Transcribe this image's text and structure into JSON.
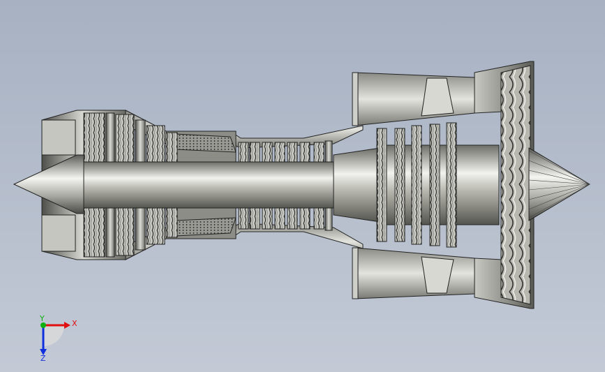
{
  "viewport": {
    "background_top": "#a7b1c2",
    "background_bottom": "#c3cad6"
  },
  "model": {
    "metal_dark": "#5a5a55",
    "metal_mid": "#a9a9a2",
    "metal_light": "#eeeeea",
    "edge": "#222222"
  },
  "triad": {
    "x_label": "X",
    "y_label": "Y",
    "z_label": "Z",
    "x_color": "#e01010",
    "y_color": "#10b010",
    "z_color": "#1030e0"
  }
}
